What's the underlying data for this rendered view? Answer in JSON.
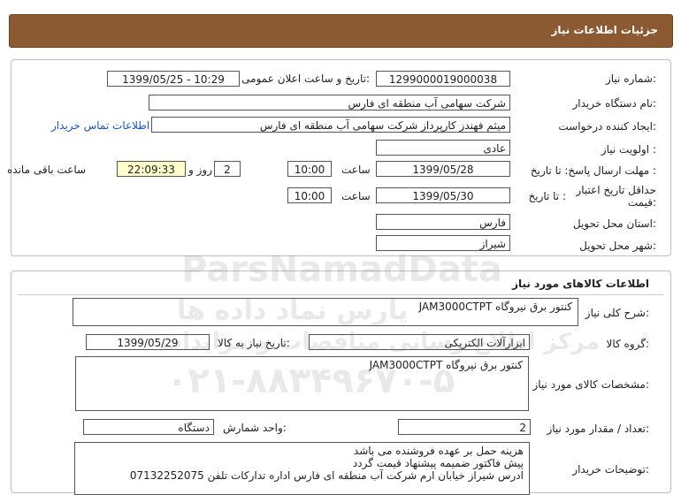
{
  "header": {
    "title": "جزئیات اطلاعات نیاز"
  },
  "info": {
    "need_number_label": "شماره نیاز:",
    "need_number": "1299000019000038",
    "announce_label": "تاریخ و ساعت اعلان عمومی:",
    "announce_value": "1399/05/25 - 10:29",
    "buyer_org_label": "نام دستگاه خریدار:",
    "buyer_org": "شرکت سهامی آب منطقه ای فارس",
    "requester_label": "ایجاد کننده درخواست:",
    "requester": "میثم فهندز کارپرداز شرکت سهامی آب منطقه ای فارس",
    "contact_link": "اطلاعات تماس خریدار",
    "priority_label": "اولویت نیاز :",
    "priority": "عادی",
    "deadline_label": "مهلت ارسال پاسخ: تا تاریخ :",
    "deadline_date": "1399/05/28",
    "time_label": "ساعت",
    "deadline_time": "10:00",
    "days_value": "2",
    "days_label": "روز و",
    "remaining_time": "22:09:33",
    "remaining_label": "ساعت باقی مانده",
    "validity_label": "حداقل تاریخ اعتبار قیمت:",
    "validity_to_label": "تا تاریخ :",
    "validity_date": "1399/05/30",
    "validity_time": "10:00",
    "province_label": "استان محل تحویل:",
    "province": "فارس",
    "city_label": "شهر محل تحویل:",
    "city": "شیراز"
  },
  "goods": {
    "section_title": "اطلاعات کالاهای مورد نیاز",
    "general_desc_label": "شرح کلی نیاز:",
    "general_desc": "کنتور برق نیروگاه  JAM3000CTPT",
    "group_label": "گروه کالا:",
    "group_value": "ابزارآلات الکتریکی",
    "need_date_label": "تاریخ نیاز به کالا:",
    "need_date": "1399/05/29",
    "spec_label": "مشخصات کالای مورد نیاز:",
    "spec_value": "کنتور برق نیروگاه  JAM3000CTPT",
    "qty_label": "تعداد / مقدار مورد نیاز:",
    "qty_value": "2",
    "unit_label": "واحد شمارش:",
    "unit_value": "دستگاه",
    "buyer_notes_label": "توضیحات خریدار:",
    "buyer_notes": [
      "هزینه حمل بر عهده فروشنده می باشد",
      "پیش فاکتور ضمیمه پیشنهاد قیمت گردد",
      "ادرس شیراز خیابان ارم شرکت آب منطقه ای فارس اداره تدارکات تلفن 07132252075"
    ]
  },
  "watermark": {
    "brand": "ParsNamadData",
    "line1": "پارس نماد داده ها",
    "line2": "مرکز اطلاع رسانی مناقصات و مزایدات",
    "phone": "۰۲۱-۸۸۳۴۹۶۷۰-۵"
  }
}
